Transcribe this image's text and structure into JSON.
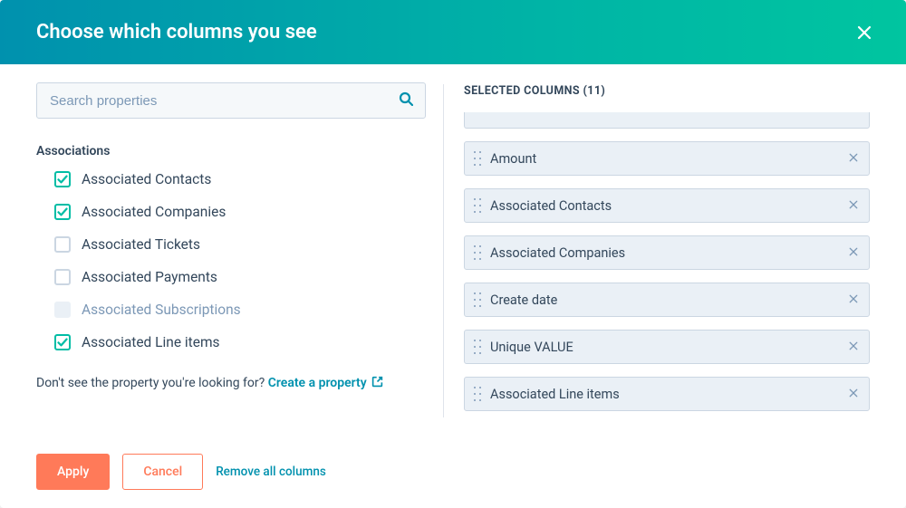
{
  "header": {
    "title": "Choose which columns you see"
  },
  "search": {
    "placeholder": "Search properties"
  },
  "left": {
    "group_heading": "Associations",
    "items": [
      {
        "label": "Associated Contacts",
        "checked": true,
        "disabled": false
      },
      {
        "label": "Associated Companies",
        "checked": true,
        "disabled": false
      },
      {
        "label": "Associated Tickets",
        "checked": false,
        "disabled": false
      },
      {
        "label": "Associated Payments",
        "checked": false,
        "disabled": false
      },
      {
        "label": "Associated Subscriptions",
        "checked": false,
        "disabled": true
      },
      {
        "label": "Associated Line items",
        "checked": true,
        "disabled": false
      }
    ],
    "helper_prefix": "Don't see the property you're looking for? ",
    "helper_link": "Create a property"
  },
  "footer": {
    "apply": "Apply",
    "cancel": "Cancel",
    "remove_all": "Remove all columns"
  },
  "right": {
    "heading": "SELECTED COLUMNS (11)",
    "columns": [
      {
        "label": "Amount"
      },
      {
        "label": "Associated Contacts"
      },
      {
        "label": "Associated Companies"
      },
      {
        "label": "Create date"
      },
      {
        "label": "Unique VALUE"
      },
      {
        "label": "Associated Line items"
      }
    ]
  }
}
